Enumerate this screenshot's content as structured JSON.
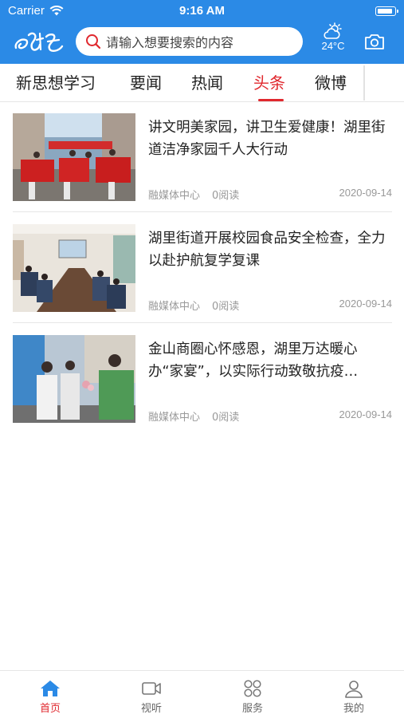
{
  "status_bar": {
    "carrier": "Carrier",
    "time": "9:16 AM",
    "battery_level": 0.9
  },
  "header": {
    "logo": "鄂阳",
    "search_placeholder": "请输入想要搜索的内容",
    "weather": {
      "icon": "partly-cloudy-icon",
      "temperature": "24°C"
    },
    "camera_icon": "camera-icon"
  },
  "tabs": {
    "items": [
      {
        "label": "新思想学习"
      },
      {
        "label": "要闻"
      },
      {
        "label": "热闻"
      },
      {
        "label": "头条",
        "active": true
      },
      {
        "label": "微博"
      }
    ]
  },
  "news": [
    {
      "title": "讲文明美家园，讲卫生爱健康！湖里街道洁净家园千人大行动",
      "source": "融媒体中心",
      "reads": "0阅读",
      "date": "2020-09-14"
    },
    {
      "title": "湖里街道开展校园食品安全检查，全力以赴护航复学复课",
      "source": "融媒体中心",
      "reads": "0阅读",
      "date": "2020-09-14"
    },
    {
      "title": "金山商圈心怀感恩，湖里万达暖心办“家宴”，以实际行动致敬抗疫…",
      "source": "融媒体中心",
      "reads": "0阅读",
      "date": "2020-09-14"
    }
  ],
  "tabbar": {
    "items": [
      {
        "label": "首页",
        "icon": "home-icon",
        "active": true
      },
      {
        "label": "视听",
        "icon": "video-icon"
      },
      {
        "label": "服务",
        "icon": "grid-icon"
      },
      {
        "label": "我的",
        "icon": "user-icon"
      }
    ]
  },
  "colors": {
    "accent": "#2b8ae6",
    "active_red": "#e0282e"
  }
}
